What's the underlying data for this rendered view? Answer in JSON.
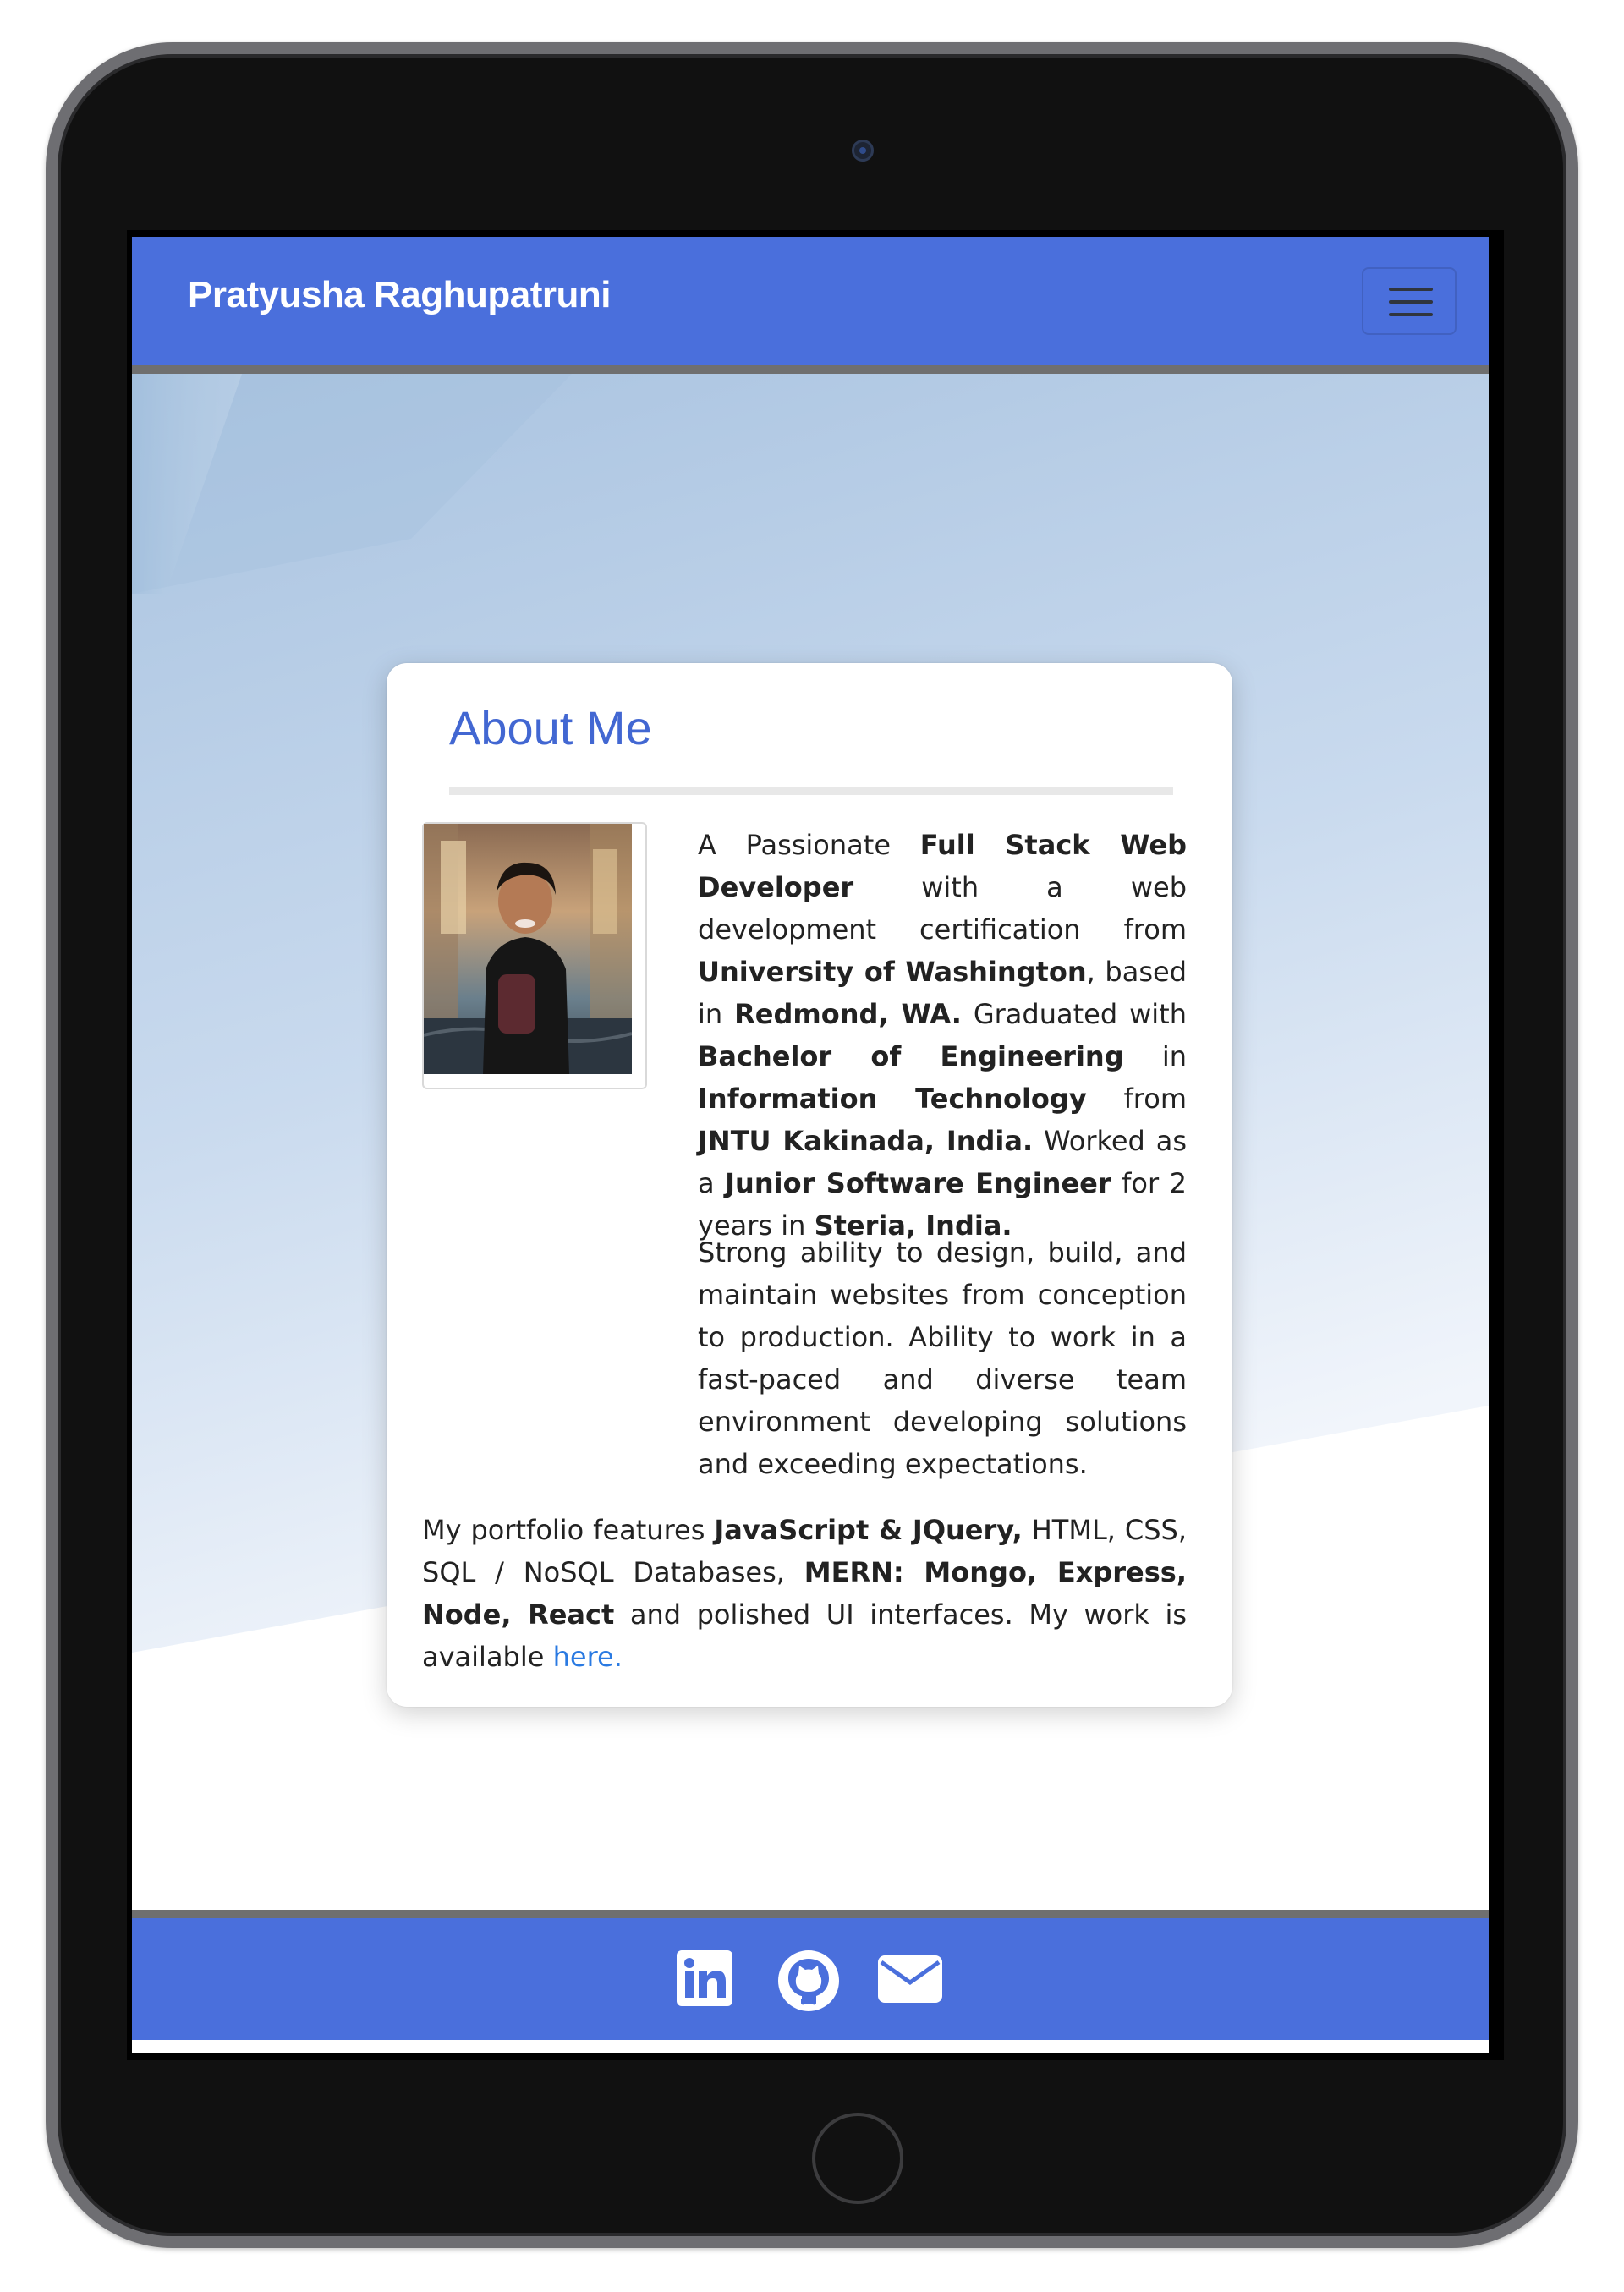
{
  "navbar": {
    "brand": "Pratyusha Raghupatruni",
    "toggler_icon": "hamburger-menu-icon"
  },
  "about": {
    "title": "About Me",
    "intro": {
      "p1": "A Passionate ",
      "b1": "Full Stack Web Developer",
      "p2": " with a web development certification from ",
      "b2": "University of Washington",
      "p3": ", based in ",
      "b3": "Redmond, WA.",
      "p4": " Graduated with ",
      "b4": "Bachelor of Engineering",
      "p5": " in ",
      "b5": "Information Technology",
      "p6": " from ",
      "b6": "JNTU Kakinada, India.",
      "p7": " Worked as a ",
      "b7": "Junior Software Engineer",
      "p8": " for 2 years in ",
      "b8": "Steria, India."
    },
    "strengths": "Strong ability to design, build, and maintain websites from conception to production. Ability to work in a fast-paced and diverse team environment developing solutions and exceeding expectations.",
    "portfolio": {
      "p1": "My portfolio features ",
      "b1": "JavaScript & JQuery,",
      "p2": " HTML, CSS, SQL / NoSQL Databases, ",
      "b2": "MERN: Mongo, Express, Node, React",
      "p3": " and polished UI interfaces. My work is available ",
      "link": "here."
    }
  },
  "footer": {
    "icons": [
      "linkedin-icon",
      "github-icon",
      "envelope-icon"
    ]
  },
  "colors": {
    "navbar": "#4a6fdc",
    "title": "#4267d2",
    "link": "#2a7ae2",
    "divider_bar": "#6f6f6f"
  }
}
